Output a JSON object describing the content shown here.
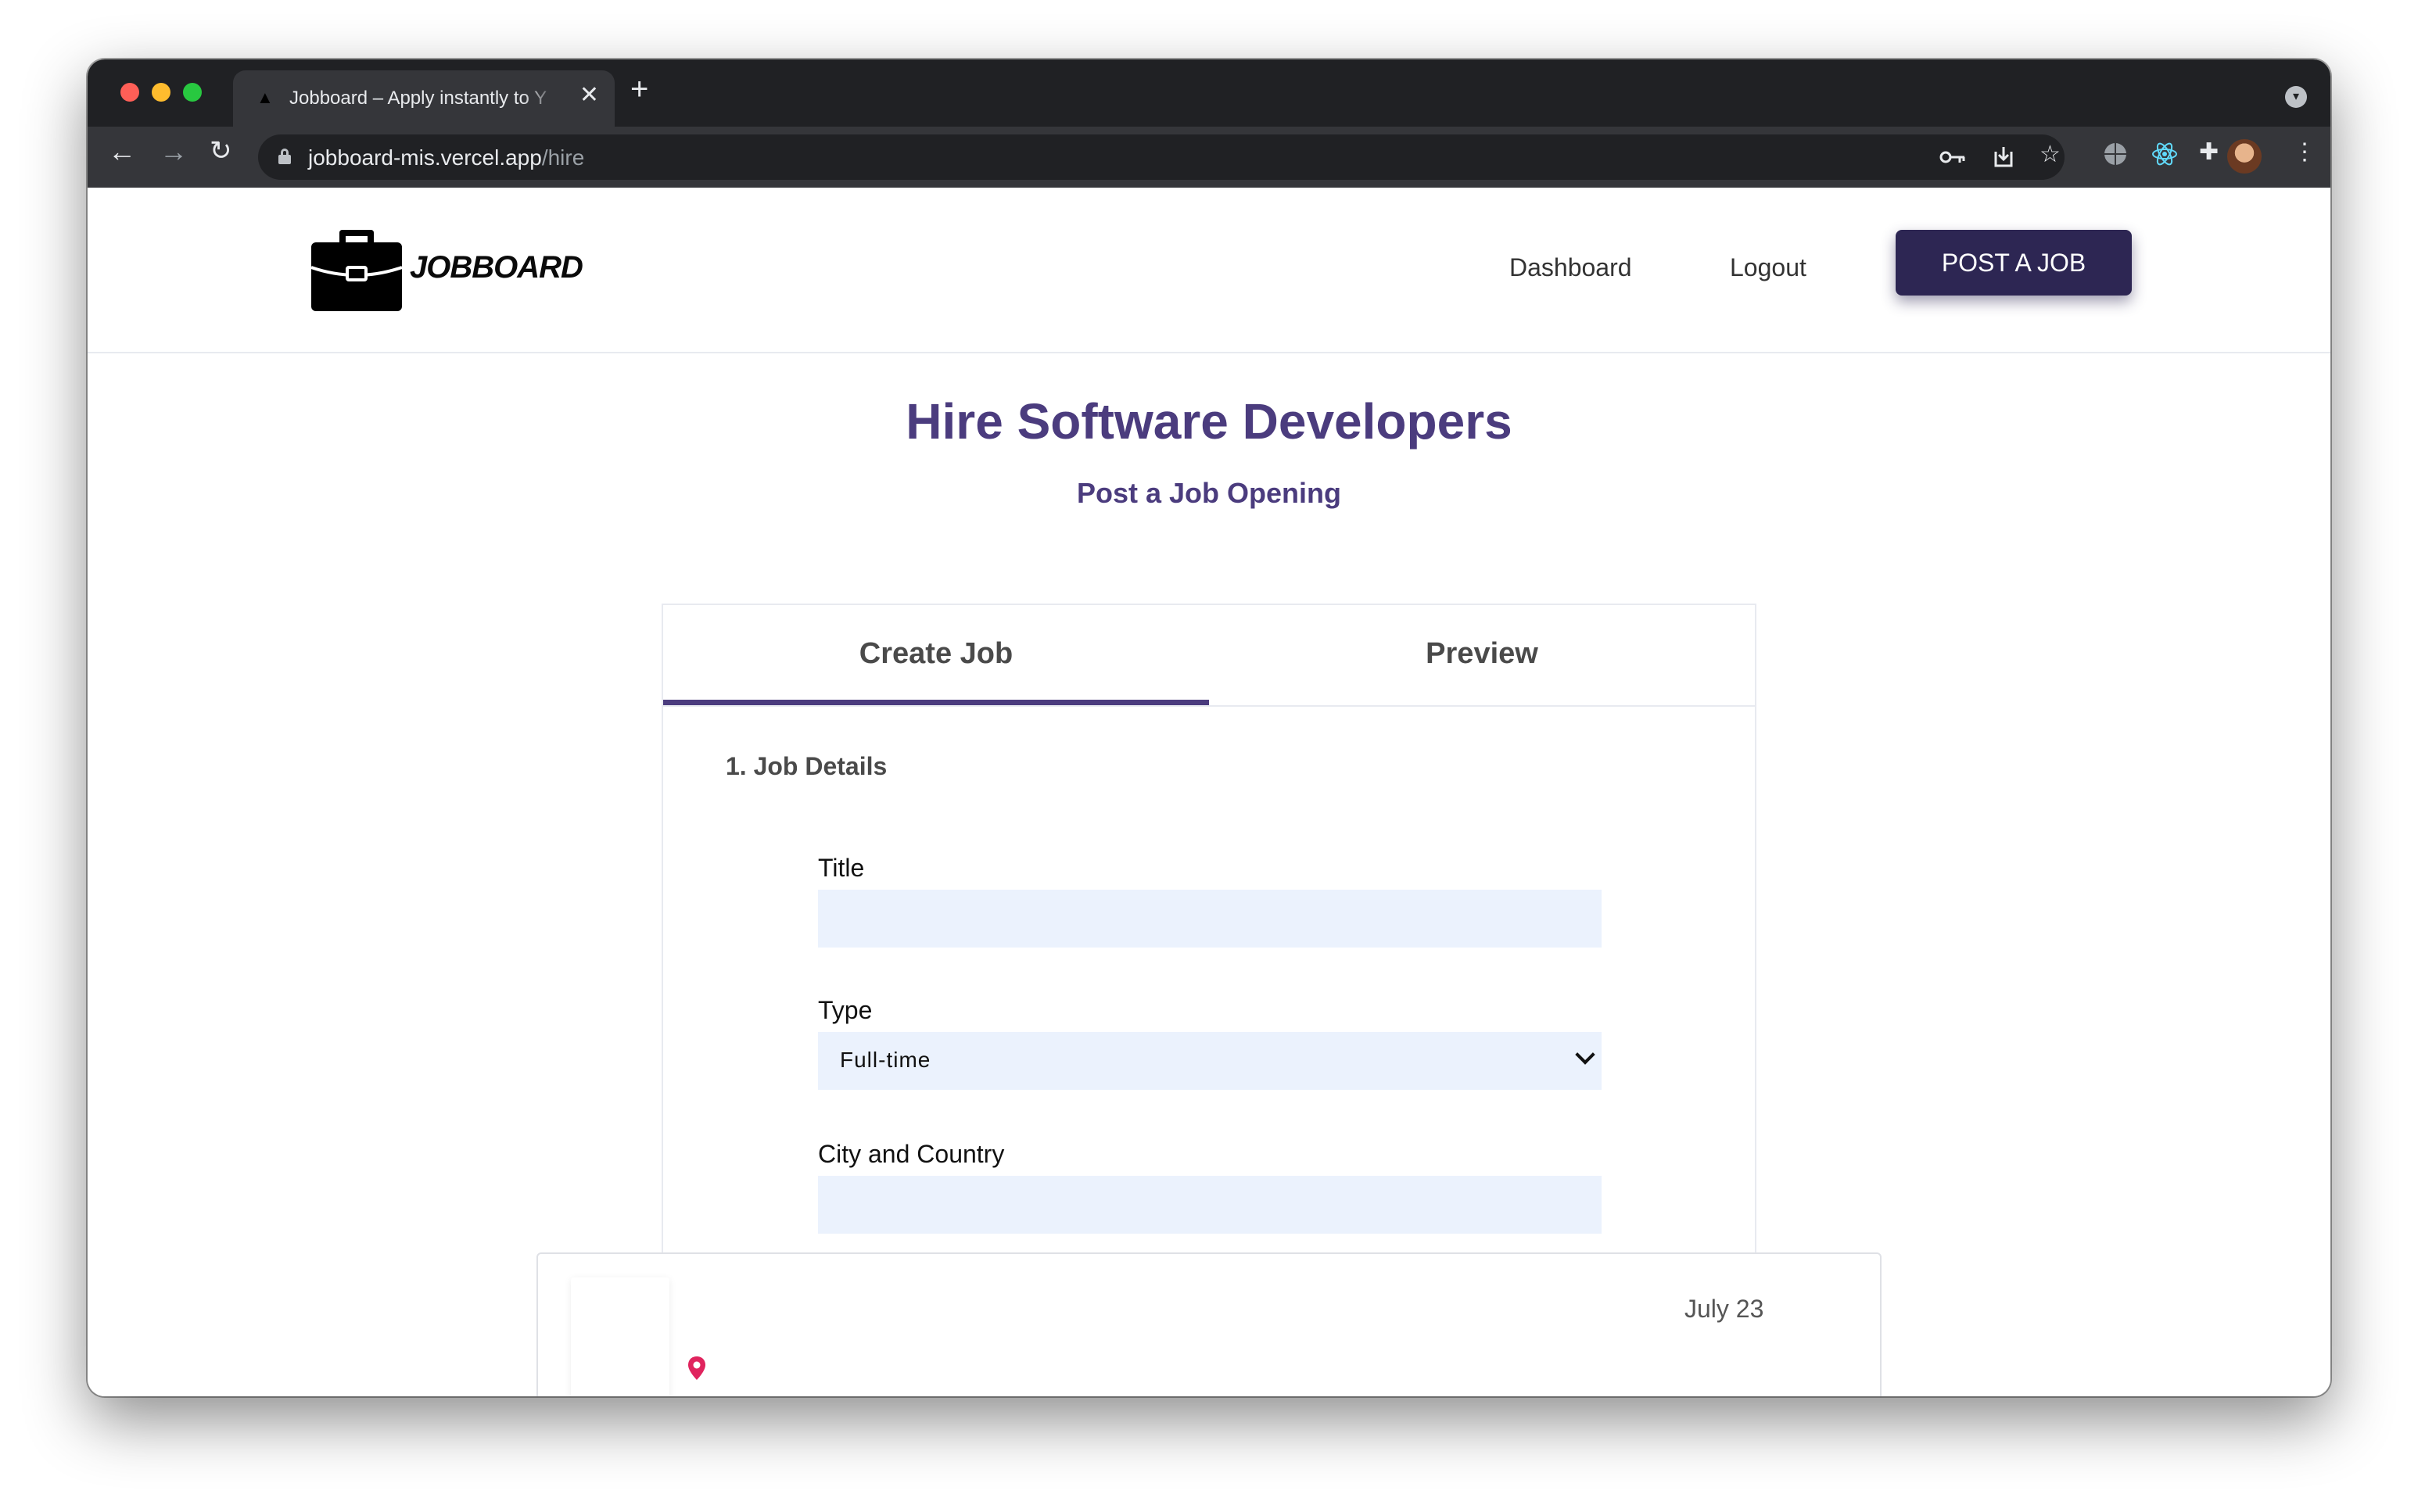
{
  "browser": {
    "tab_title": "Jobboard – Apply instantly to Y",
    "tab_close": "✕",
    "new_tab": "+",
    "url_host": "jobboard-mis.vercel.app",
    "url_path": "/hire",
    "icons": [
      "back-arrow-icon",
      "forward-arrow-icon",
      "reload-icon",
      "lock-icon",
      "key-icon",
      "install-icon",
      "star-icon",
      "globe-icon",
      "react-devtools-icon",
      "extensions-icon",
      "profile-avatar",
      "more-menu-icon"
    ]
  },
  "site": {
    "logo_text": "JOBBOARD",
    "nav": {
      "dashboard": "Dashboard",
      "logout": "Logout"
    },
    "post_button": "POST A JOB"
  },
  "hero": {
    "title": "Hire Software Developers",
    "subtitle": "Post a Job Opening"
  },
  "form": {
    "tabs": [
      {
        "label": "Create Job",
        "active": true
      },
      {
        "label": "Preview",
        "active": false
      }
    ],
    "section": "1. Job Details",
    "fields": {
      "title_label": "Title",
      "title_value": "",
      "type_label": "Type",
      "type_value": "Full-time",
      "location_label": "City and Country"
    }
  },
  "preview_card": {
    "date": "July 23",
    "pin_color": "#e0245e"
  },
  "colors": {
    "brand": "#4b3c7e",
    "button": "#2d2653",
    "field_bg": "#ebf2fd"
  }
}
